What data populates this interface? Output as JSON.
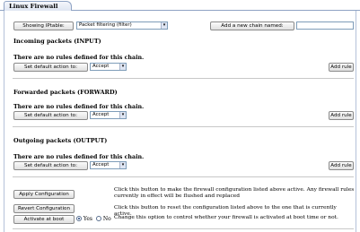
{
  "tab": {
    "title": "Linux Firewall"
  },
  "toolbar": {
    "show_button": "Showing IPtable:",
    "table_select": "Packet filtering (filter)",
    "add_chain_button": "Add a new chain named:",
    "chain_name_value": ""
  },
  "sections": [
    {
      "title": "Incoming packets (INPUT)",
      "message": "There are no rules defined for this chain.",
      "default_button": "Set default action to:",
      "action_value": "Accept",
      "add_rule_button": "Add rule"
    },
    {
      "title": "Forwarded packets (FORWARD)",
      "message": "There are no rules defined for this chain.",
      "default_button": "Set default action to:",
      "action_value": "Accept",
      "add_rule_button": "Add rule"
    },
    {
      "title": "Outgoing packets (OUTPUT)",
      "message": "There are no rules defined for this chain.",
      "default_button": "Set default action to:",
      "action_value": "Accept",
      "add_rule_button": "Add rule"
    }
  ],
  "footer": {
    "apply_button": "Apply Configuration",
    "apply_desc": "Click this button to make the firewall configuration listed above active. Any firewall rules currently in effect will be flushed and replaced",
    "revert_button": "Revert Configuration",
    "revert_desc": "Click this button to reset the configuration listed above to the one that is currently active.",
    "boot_button": "Activate at boot",
    "yes_label": "Yes",
    "no_label": "No",
    "boot_selected": "Yes",
    "boot_desc": "Change this option to control whether your firewall is activated at boot time or not."
  }
}
